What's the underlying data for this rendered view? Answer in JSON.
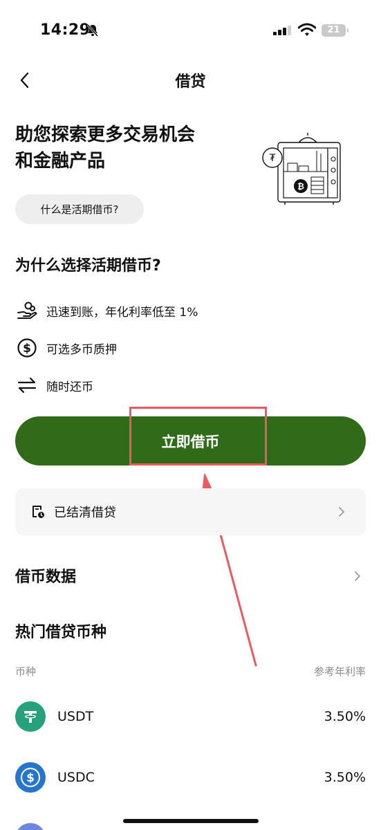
{
  "status_bar": {
    "time": "14:29",
    "battery": "21"
  },
  "nav": {
    "title": "借贷",
    "back_icon": "chevron-left-icon"
  },
  "hero": {
    "title_line1": "助您探索更多交易机会",
    "title_line2": "和金融产品",
    "chip_label": "什么是活期借币?"
  },
  "why": {
    "title": "为什么选择活期借币?",
    "features": [
      {
        "icon": "hand-coins-icon",
        "text": "迅速到账，年化利率低至 1%"
      },
      {
        "icon": "dollar-circle-icon",
        "text": "可选多币质押"
      },
      {
        "icon": "swap-arrows-icon",
        "text": "随时还币"
      }
    ]
  },
  "cta": {
    "label": "立即借币",
    "color": "#2f6b18"
  },
  "settled": {
    "label": "已结清借贷"
  },
  "stats": {
    "title": "借币数据"
  },
  "hot": {
    "title": "热门借贷币种",
    "col_coin": "币种",
    "col_rate": "参考年利率",
    "coins": [
      {
        "name": "USDT",
        "rate": "3.50%",
        "color": "#26a17b"
      },
      {
        "name": "USDC",
        "rate": "3.50%",
        "color": "#2775ca"
      }
    ]
  },
  "annotation": {
    "highlight_color": "#e85a5e"
  }
}
